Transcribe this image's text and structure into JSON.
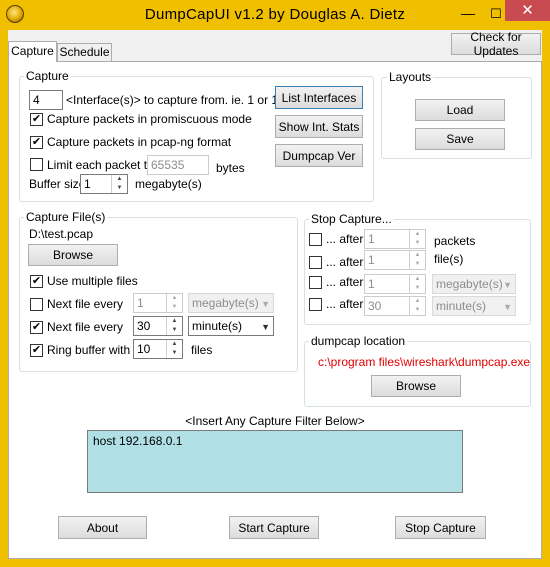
{
  "window": {
    "title": "DumpCapUI  v1.2   by Douglas A. Dietz",
    "minimize": "—",
    "maximize": "☐",
    "close": "✕"
  },
  "tabs": [
    {
      "label": "Capture"
    },
    {
      "label": "Schedule"
    }
  ],
  "check_updates_label": "Check for Updates",
  "capture_group": {
    "title": "Capture",
    "interface_value": "4",
    "interface_hint": "<Interface(s)> to capture from. ie. 1 or 1;2",
    "promiscuous_label": "Capture packets in promiscuous mode",
    "promiscuous_checked": true,
    "pcapng_label": "Capture packets in pcap-ng format",
    "pcapng_checked": true,
    "limit_label": "Limit each packet to",
    "limit_checked": false,
    "limit_value": "65535",
    "limit_unit": "bytes",
    "buffer_label": "Buffer size",
    "buffer_value": "1",
    "buffer_unit": "megabyte(s)",
    "list_interfaces_label": "List Interfaces",
    "show_stats_label": "Show Int. Stats",
    "dumpcap_ver_label": "Dumpcap Ver"
  },
  "layouts_group": {
    "title": "Layouts",
    "load_label": "Load",
    "save_label": "Save"
  },
  "capture_files_group": {
    "title": "Capture File(s)",
    "path": "D:\\test.pcap",
    "browse_label": "Browse",
    "multiple_files_label": "Use multiple files",
    "multiple_files_checked": true,
    "next_file_size_label": "Next file every",
    "next_file_size_checked": false,
    "next_file_size_value": "1",
    "next_file_size_unit": "megabyte(s)",
    "next_file_time_label": "Next file every",
    "next_file_time_checked": true,
    "next_file_time_value": "30",
    "next_file_time_unit": "minute(s)",
    "ring_buffer_label": "Ring buffer with",
    "ring_buffer_checked": true,
    "ring_buffer_value": "10",
    "ring_buffer_unit": "files"
  },
  "stop_capture_group": {
    "title": "Stop Capture...",
    "rows": [
      {
        "label": "... after",
        "value": "1",
        "unit": "packets",
        "checked": false
      },
      {
        "label": "... after",
        "value": "1",
        "unit": "file(s)",
        "checked": false
      },
      {
        "label": "... after",
        "value": "1",
        "unit": "megabyte(s)",
        "checked": false
      },
      {
        "label": "... after",
        "value": "30",
        "unit": "minute(s)",
        "checked": false
      }
    ]
  },
  "dumpcap_location_group": {
    "title": "dumpcap location",
    "path": "c:\\program files\\wireshark\\dumpcap.exe",
    "browse_label": "Browse"
  },
  "filter": {
    "label": "<Insert Any Capture Filter Below>",
    "value": "host 192.168.0.1"
  },
  "bottom_buttons": {
    "about": "About",
    "start": "Start Capture",
    "stop": "Stop Capture"
  },
  "colors": {
    "title_bar": "#f0c000",
    "close_button": "#c74b50",
    "filter_bg": "#b0e0e6",
    "dumpcap_path": "#e00000"
  }
}
